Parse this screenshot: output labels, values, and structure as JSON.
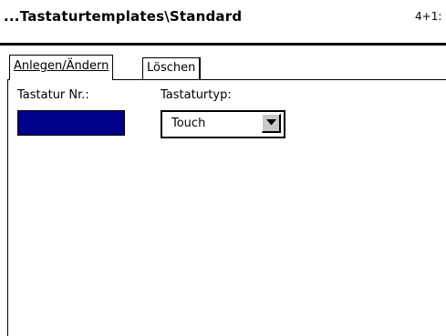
{
  "window": {
    "title": "...Tastaturtemplates\\Standard",
    "status": "4+1:"
  },
  "tabs": [
    {
      "label": "Anlegen/Ändern",
      "active": true
    },
    {
      "label": "Löschen",
      "active": false
    }
  ],
  "form": {
    "keyboard_nr_label": "Tastatur Nr.:",
    "keyboard_nr_value": "",
    "keyboard_type_label": "Tastaturtyp:",
    "keyboard_type_value": "Touch"
  },
  "icons": {
    "dropdown": "chevron-down-icon"
  },
  "colors": {
    "selected_field": "#00008b",
    "button_face": "#c8c8c8"
  }
}
